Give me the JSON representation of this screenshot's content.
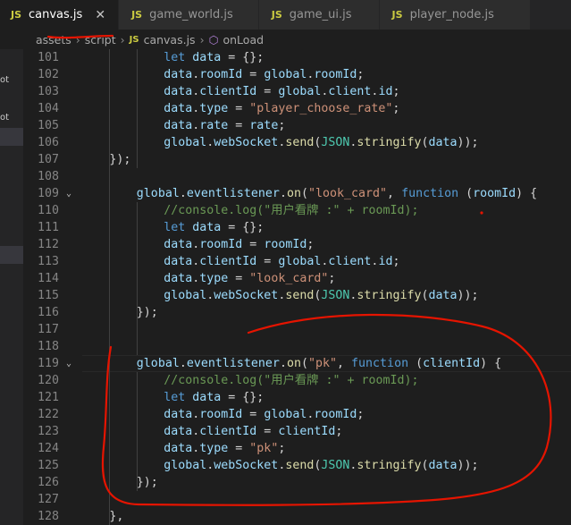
{
  "tabs": [
    {
      "icon": "JS",
      "label": "canvas.js",
      "active": true,
      "close": "✕"
    },
    {
      "icon": "JS",
      "label": "game_world.js",
      "active": false
    },
    {
      "icon": "JS",
      "label": "game_ui.js",
      "active": false
    },
    {
      "icon": "JS",
      "label": "player_node.js",
      "active": false
    }
  ],
  "breadcrumb": {
    "part1": "assets",
    "part2": "script",
    "file_icon": "JS",
    "file": "canvas.js",
    "symbol": "onLoad"
  },
  "left_panel": [
    "ot",
    "ot"
  ],
  "colors": {
    "keyword": "#569cd6",
    "variable": "#9cdcfe",
    "function": "#dcdcaa",
    "string": "#ce9178",
    "comment": "#6a9955",
    "annotation": "#e51400"
  },
  "lines": [
    {
      "n": "101",
      "t": [
        [
          "k",
          "let"
        ],
        [
          "p",
          " "
        ],
        [
          "v",
          "data"
        ],
        [
          "p",
          " = {};"
        ]
      ]
    },
    {
      "n": "102",
      "t": [
        [
          "v",
          "data"
        ],
        [
          "p",
          "."
        ],
        [
          "v",
          "roomId"
        ],
        [
          "p",
          " = "
        ],
        [
          "v",
          "global"
        ],
        [
          "p",
          "."
        ],
        [
          "v",
          "roomId"
        ],
        [
          "p",
          ";"
        ]
      ]
    },
    {
      "n": "103",
      "t": [
        [
          "v",
          "data"
        ],
        [
          "p",
          "."
        ],
        [
          "v",
          "clientId"
        ],
        [
          "p",
          " = "
        ],
        [
          "v",
          "global"
        ],
        [
          "p",
          "."
        ],
        [
          "v",
          "client"
        ],
        [
          "p",
          "."
        ],
        [
          "v",
          "id"
        ],
        [
          "p",
          ";"
        ]
      ]
    },
    {
      "n": "104",
      "t": [
        [
          "v",
          "data"
        ],
        [
          "p",
          "."
        ],
        [
          "v",
          "type"
        ],
        [
          "p",
          " = "
        ],
        [
          "s",
          "\"player_choose_rate\""
        ],
        [
          "p",
          ";"
        ]
      ]
    },
    {
      "n": "105",
      "t": [
        [
          "v",
          "data"
        ],
        [
          "p",
          "."
        ],
        [
          "v",
          "rate"
        ],
        [
          "p",
          " = "
        ],
        [
          "v",
          "rate"
        ],
        [
          "p",
          ";"
        ]
      ]
    },
    {
      "n": "106",
      "t": [
        [
          "v",
          "global"
        ],
        [
          "p",
          "."
        ],
        [
          "v",
          "webSocket"
        ],
        [
          "p",
          "."
        ],
        [
          "f",
          "send"
        ],
        [
          "p",
          "("
        ],
        [
          "t",
          "JSON"
        ],
        [
          "p",
          "."
        ],
        [
          "f",
          "stringify"
        ],
        [
          "p",
          "("
        ],
        [
          "v",
          "data"
        ],
        [
          "p",
          "));"
        ]
      ]
    },
    {
      "n": "107",
      "t": [
        [
          "p",
          "});"
        ]
      ]
    },
    {
      "n": "108",
      "t": []
    },
    {
      "n": "109",
      "t": [
        [
          "v",
          "global"
        ],
        [
          "p",
          "."
        ],
        [
          "v",
          "eventlistener"
        ],
        [
          "p",
          "."
        ],
        [
          "f",
          "on"
        ],
        [
          "p",
          "("
        ],
        [
          "s",
          "\"look_card\""
        ],
        [
          "p",
          ", "
        ],
        [
          "k",
          "function"
        ],
        [
          "p",
          " ("
        ],
        [
          "v",
          "roomId"
        ],
        [
          "p",
          ") {"
        ]
      ]
    },
    {
      "n": "110",
      "t": [
        [
          "c",
          "//console.log(\"用户看牌 :\" + roomId);"
        ]
      ]
    },
    {
      "n": "111",
      "t": [
        [
          "k",
          "let"
        ],
        [
          "p",
          " "
        ],
        [
          "v",
          "data"
        ],
        [
          "p",
          " = {};"
        ]
      ]
    },
    {
      "n": "112",
      "t": [
        [
          "v",
          "data"
        ],
        [
          "p",
          "."
        ],
        [
          "v",
          "roomId"
        ],
        [
          "p",
          " = "
        ],
        [
          "v",
          "roomId"
        ],
        [
          "p",
          ";"
        ]
      ]
    },
    {
      "n": "113",
      "t": [
        [
          "v",
          "data"
        ],
        [
          "p",
          "."
        ],
        [
          "v",
          "clientId"
        ],
        [
          "p",
          " = "
        ],
        [
          "v",
          "global"
        ],
        [
          "p",
          "."
        ],
        [
          "v",
          "client"
        ],
        [
          "p",
          "."
        ],
        [
          "v",
          "id"
        ],
        [
          "p",
          ";"
        ]
      ]
    },
    {
      "n": "114",
      "t": [
        [
          "v",
          "data"
        ],
        [
          "p",
          "."
        ],
        [
          "v",
          "type"
        ],
        [
          "p",
          " = "
        ],
        [
          "s",
          "\"look_card\""
        ],
        [
          "p",
          ";"
        ]
      ]
    },
    {
      "n": "115",
      "t": [
        [
          "v",
          "global"
        ],
        [
          "p",
          "."
        ],
        [
          "v",
          "webSocket"
        ],
        [
          "p",
          "."
        ],
        [
          "f",
          "send"
        ],
        [
          "p",
          "("
        ],
        [
          "t",
          "JSON"
        ],
        [
          "p",
          "."
        ],
        [
          "f",
          "stringify"
        ],
        [
          "p",
          "("
        ],
        [
          "v",
          "data"
        ],
        [
          "p",
          "));"
        ]
      ]
    },
    {
      "n": "116",
      "t": [
        [
          "p",
          "});"
        ]
      ]
    },
    {
      "n": "117",
      "t": []
    },
    {
      "n": "118",
      "t": []
    },
    {
      "n": "119",
      "t": [
        [
          "v",
          "global"
        ],
        [
          "p",
          "."
        ],
        [
          "v",
          "eventlistener"
        ],
        [
          "p",
          "."
        ],
        [
          "f",
          "on"
        ],
        [
          "p",
          "("
        ],
        [
          "s",
          "\"pk\""
        ],
        [
          "p",
          ", "
        ],
        [
          "k",
          "function"
        ],
        [
          "p",
          " ("
        ],
        [
          "v",
          "clientId"
        ],
        [
          "p",
          ") {"
        ]
      ]
    },
    {
      "n": "120",
      "t": [
        [
          "c",
          "//console.log(\"用户看牌 :\" + roomId);"
        ]
      ]
    },
    {
      "n": "121",
      "t": [
        [
          "k",
          "let"
        ],
        [
          "p",
          " "
        ],
        [
          "v",
          "data"
        ],
        [
          "p",
          " = {};"
        ]
      ]
    },
    {
      "n": "122",
      "t": [
        [
          "v",
          "data"
        ],
        [
          "p",
          "."
        ],
        [
          "v",
          "roomId"
        ],
        [
          "p",
          " = "
        ],
        [
          "v",
          "global"
        ],
        [
          "p",
          "."
        ],
        [
          "v",
          "roomId"
        ],
        [
          "p",
          ";"
        ]
      ]
    },
    {
      "n": "123",
      "t": [
        [
          "v",
          "data"
        ],
        [
          "p",
          "."
        ],
        [
          "v",
          "clientId"
        ],
        [
          "p",
          " = "
        ],
        [
          "v",
          "clientId"
        ],
        [
          "p",
          ";"
        ]
      ]
    },
    {
      "n": "124",
      "t": [
        [
          "v",
          "data"
        ],
        [
          "p",
          "."
        ],
        [
          "v",
          "type"
        ],
        [
          "p",
          " = "
        ],
        [
          "s",
          "\"pk\""
        ],
        [
          "p",
          ";"
        ]
      ]
    },
    {
      "n": "125",
      "t": [
        [
          "v",
          "global"
        ],
        [
          "p",
          "."
        ],
        [
          "v",
          "webSocket"
        ],
        [
          "p",
          "."
        ],
        [
          "f",
          "send"
        ],
        [
          "p",
          "("
        ],
        [
          "t",
          "JSON"
        ],
        [
          "p",
          "."
        ],
        [
          "f",
          "stringify"
        ],
        [
          "p",
          "("
        ],
        [
          "v",
          "data"
        ],
        [
          "p",
          "));"
        ]
      ]
    },
    {
      "n": "126",
      "t": [
        [
          "p",
          "});"
        ]
      ]
    },
    {
      "n": "127",
      "t": []
    },
    {
      "n": "128",
      "t": [
        [
          "p",
          "},"
        ]
      ]
    }
  ]
}
